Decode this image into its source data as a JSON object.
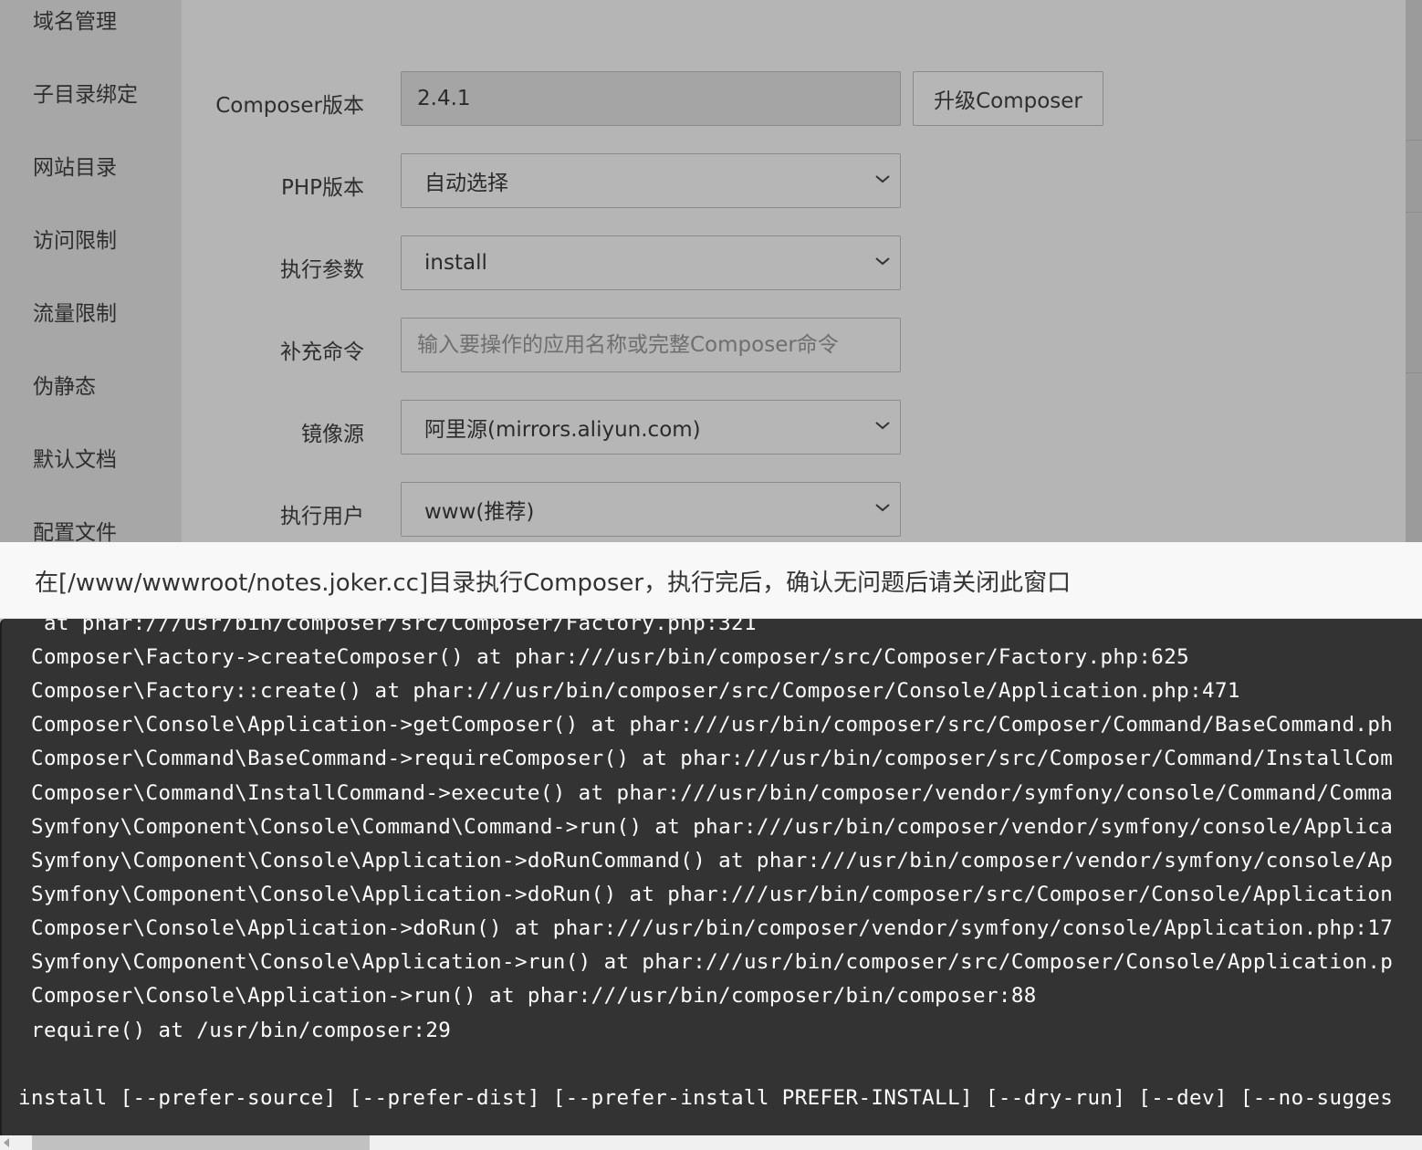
{
  "sidebar": {
    "items": [
      "域名管理",
      "子目录绑定",
      "网站目录",
      "访问限制",
      "流量限制",
      "伪静态",
      "默认文档",
      "配置文件"
    ]
  },
  "form": {
    "composer_version_label": "Composer版本",
    "composer_version_value": "2.4.1",
    "upgrade_button": "升级Composer",
    "php_version_label": "PHP版本",
    "php_version_value": "自动选择",
    "exec_params_label": "执行参数",
    "exec_params_value": "install",
    "extra_cmd_label": "补充命令",
    "extra_cmd_placeholder": "输入要操作的应用名称或完整Composer命令",
    "mirror_label": "镜像源",
    "mirror_value": "阿里源(mirrors.aliyun.com)",
    "exec_user_label": "执行用户",
    "exec_user_value": "www(推荐)"
  },
  "dialog": {
    "title": "在[/www/wwwroot/notes.joker.cc]目录执行Composer，执行完后，确认无问题后请关闭此窗口"
  },
  "terminal": {
    "lines": [
      " at phar:///usr/bin/composer/src/Composer/Factory.php:321",
      "Composer\\Factory->createComposer() at phar:///usr/bin/composer/src/Composer/Factory.php:625",
      "Composer\\Factory::create() at phar:///usr/bin/composer/src/Composer/Console/Application.php:471",
      "Composer\\Console\\Application->getComposer() at phar:///usr/bin/composer/src/Composer/Command/BaseCommand.ph",
      "Composer\\Command\\BaseCommand->requireComposer() at phar:///usr/bin/composer/src/Composer/Command/InstallCom",
      "Composer\\Command\\InstallCommand->execute() at phar:///usr/bin/composer/vendor/symfony/console/Command/Comma",
      "Symfony\\Component\\Console\\Command\\Command->run() at phar:///usr/bin/composer/vendor/symfony/console/Applica",
      "Symfony\\Component\\Console\\Application->doRunCommand() at phar:///usr/bin/composer/vendor/symfony/console/Ap",
      "Symfony\\Component\\Console\\Application->doRun() at phar:///usr/bin/composer/src/Composer/Console/Application",
      "Composer\\Console\\Application->doRun() at phar:///usr/bin/composer/vendor/symfony/console/Application.php:17",
      "Symfony\\Component\\Console\\Application->run() at phar:///usr/bin/composer/src/Composer/Console/Application.p",
      "Composer\\Console\\Application->run() at phar:///usr/bin/composer/bin/composer:88",
      "require() at /usr/bin/composer:29"
    ],
    "usage_line": "install [--prefer-source] [--prefer-dist] [--prefer-install PREFER-INSTALL] [--dry-run] [--dev] [--no-sugges"
  }
}
